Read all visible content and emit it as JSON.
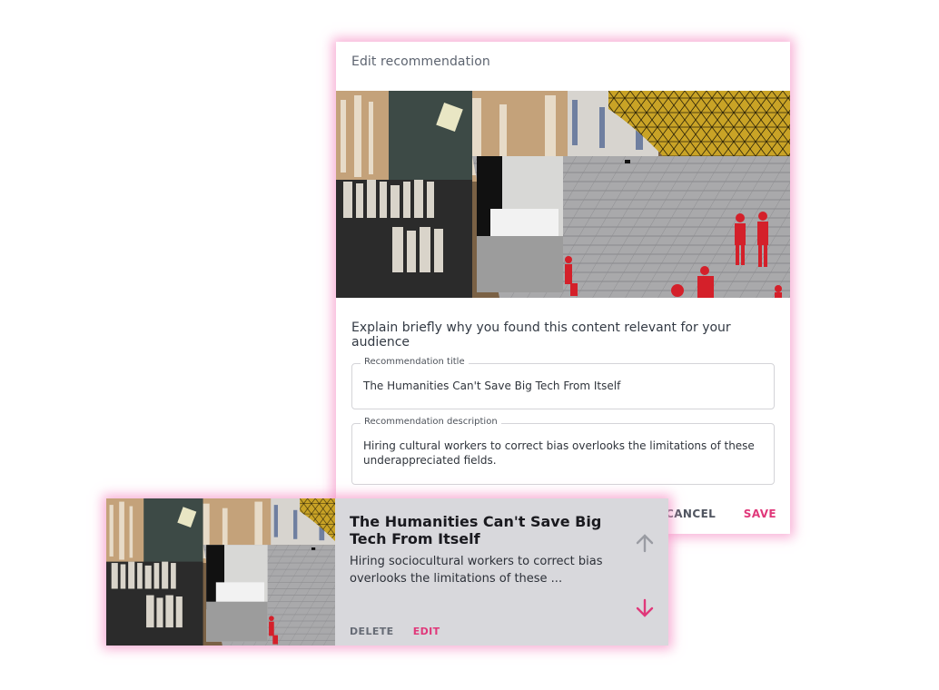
{
  "dialog": {
    "title": "Edit recommendation",
    "prompt": "Explain briefly why you found this content relevant for your audience",
    "title_field": {
      "label": "Recommendation title",
      "value": "The Humanities Can't Save Big Tech From Itself"
    },
    "description_field": {
      "label": "Recommendation description",
      "value": "Hiring cultural workers to correct bias overlooks the limitations of these underappreciated fields."
    },
    "cancel_label": "CANCEL",
    "save_label": "SAVE"
  },
  "card": {
    "title": "The Humanities Can't Save Big Tech From Itself",
    "description": "Hiring sociocultural workers to correct bias overlooks the limitations of these ...",
    "delete_label": "DELETE",
    "edit_label": "EDIT",
    "move_up_icon": "arrow-up-icon",
    "move_down_icon": "arrow-down-icon"
  },
  "colors": {
    "accent": "#e0387a",
    "glow": "#f596c8",
    "card_background": "#d8d8dc",
    "disabled_arrow": "#9a9ca3"
  }
}
